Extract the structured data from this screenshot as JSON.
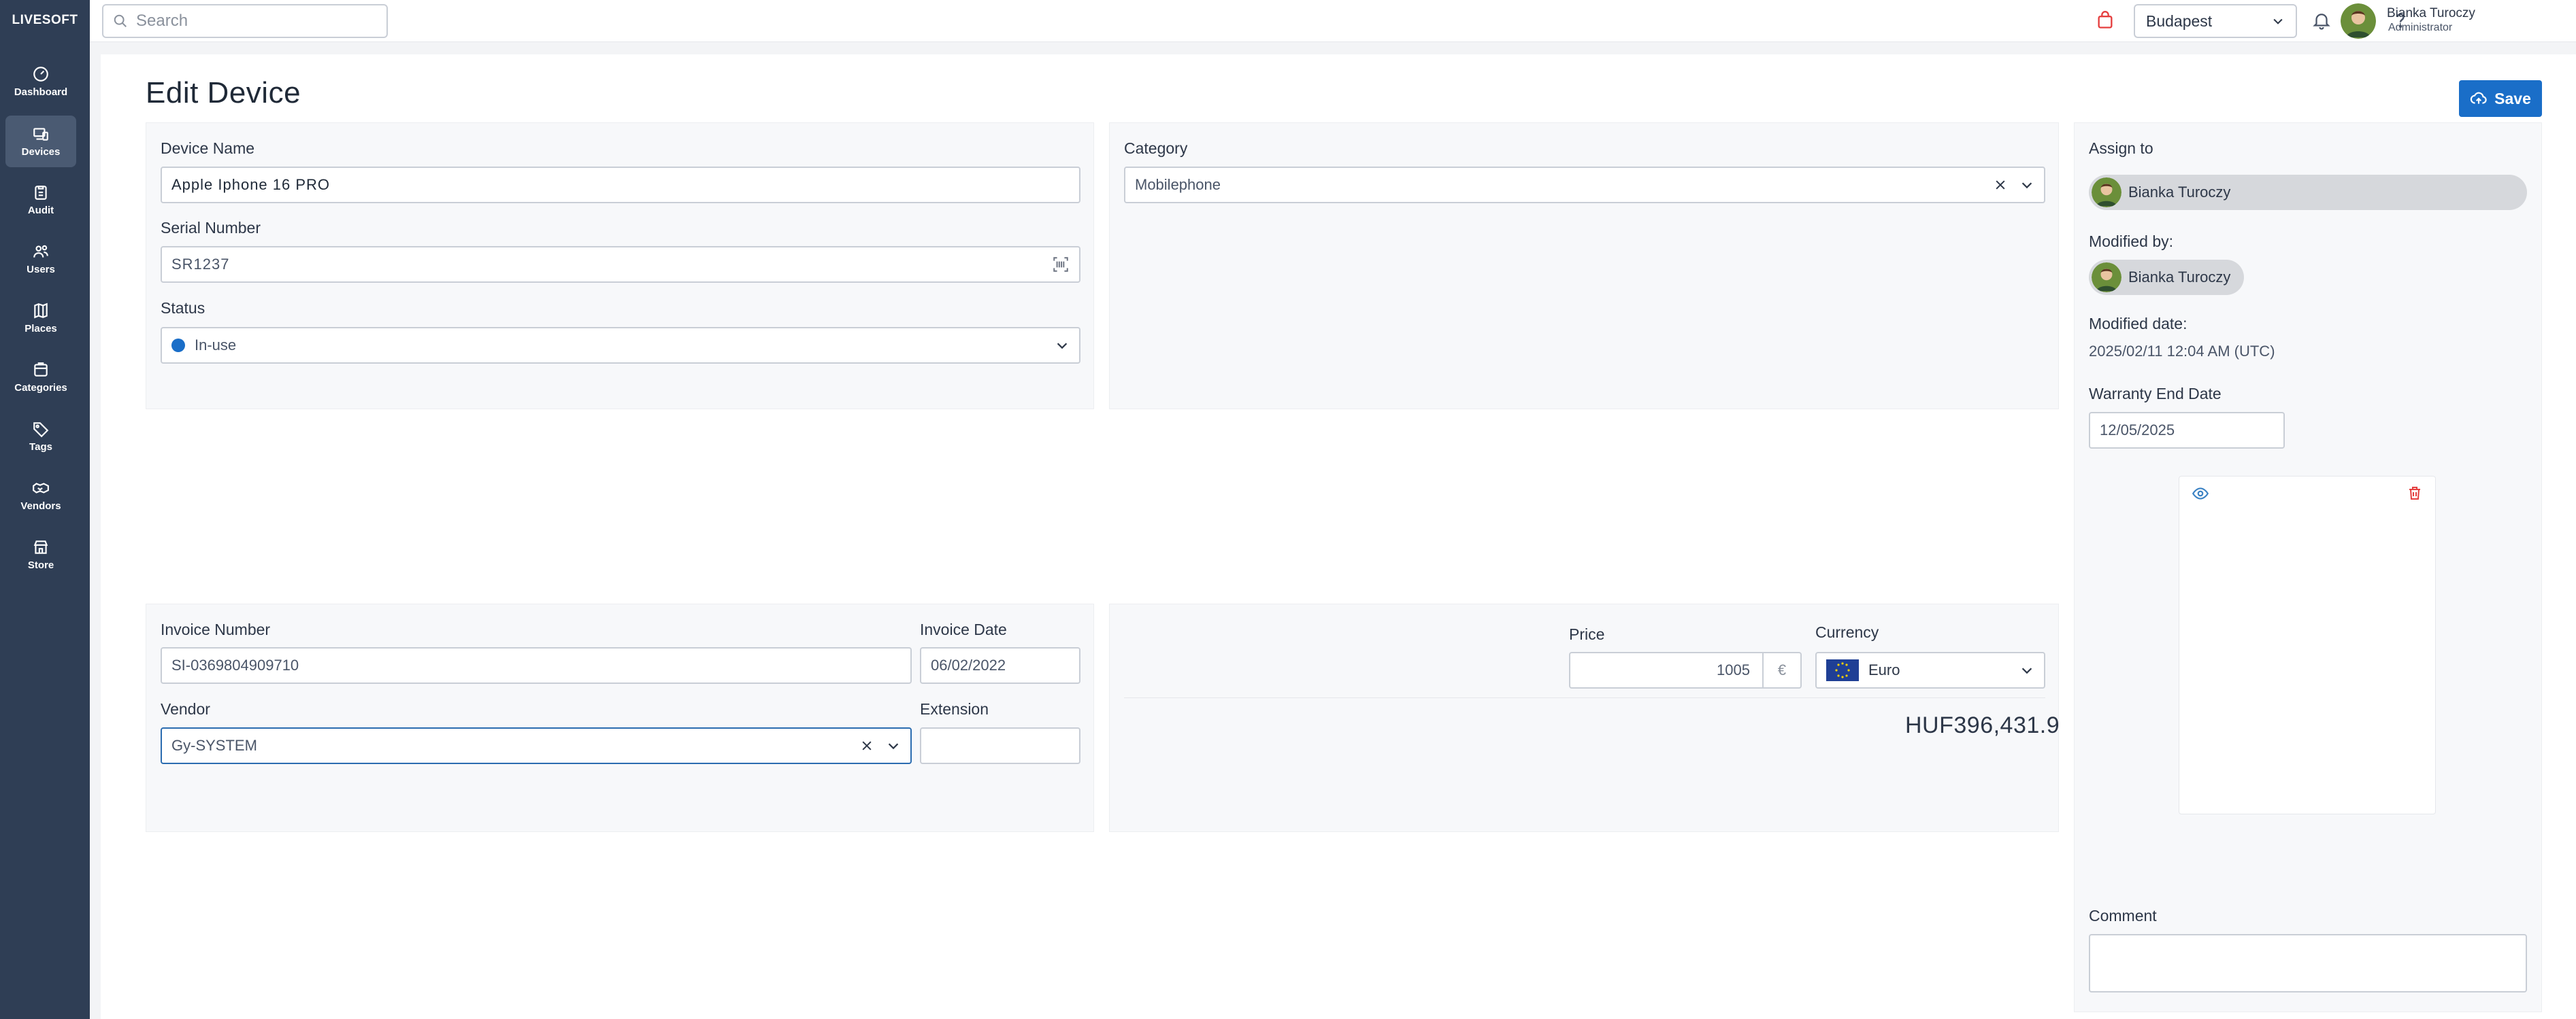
{
  "app": {
    "brand": "LIVESOFT"
  },
  "sidebar": {
    "items": [
      {
        "label": "Dashboard",
        "icon": "dashboard-icon"
      },
      {
        "label": "Devices",
        "icon": "devices-icon",
        "active": true
      },
      {
        "label": "Audit",
        "icon": "clipboard-icon"
      },
      {
        "label": "Users",
        "icon": "users-icon"
      },
      {
        "label": "Places",
        "icon": "map-icon"
      },
      {
        "label": "Categories",
        "icon": "categories-icon"
      },
      {
        "label": "Tags",
        "icon": "tag-icon"
      },
      {
        "label": "Vendors",
        "icon": "handshake-icon"
      },
      {
        "label": "Store",
        "icon": "store-icon"
      }
    ]
  },
  "topbar": {
    "search_placeholder": "Search",
    "location": "Budapest",
    "user_name": "Bianka Turoczy",
    "user_role": "Administrator"
  },
  "page": {
    "title": "Edit Device",
    "save_label": "Save"
  },
  "device": {
    "name_label": "Device Name",
    "name_value": "Apple Iphone 16 PRO",
    "serial_label": "Serial Number",
    "serial_value": "SR1237",
    "status_label": "Status",
    "status_value": "In-use",
    "category_label": "Category",
    "category_value": "Mobilephone"
  },
  "assignment": {
    "assign_label": "Assign to",
    "assign_value": "Bianka Turoczy",
    "modified_by_label": "Modified by:",
    "modified_by_value": "Bianka Turoczy",
    "modified_date_label": "Modified date:",
    "modified_date_value": "2025/02/11 12:04 AM (UTC)",
    "warranty_label": "Warranty End Date",
    "warranty_value": "12/05/2025",
    "comment_label": "Comment"
  },
  "invoice": {
    "number_label": "Invoice Number",
    "number_value": "SI-0369804909710",
    "date_label": "Invoice Date",
    "date_value": "06/02/2022",
    "vendor_label": "Vendor",
    "vendor_value": "Gy-SYSTEM",
    "extension_label": "Extension",
    "extension_value": ""
  },
  "pricing": {
    "price_label": "Price",
    "price_value": "1005",
    "price_symbol": "€",
    "currency_label": "Currency",
    "currency_value": "Euro",
    "converted_total": "HUF396,431.9"
  },
  "colors": {
    "sidebar": "#2f3e55",
    "accent": "#1a6ec8",
    "danger": "#e53e3e"
  }
}
